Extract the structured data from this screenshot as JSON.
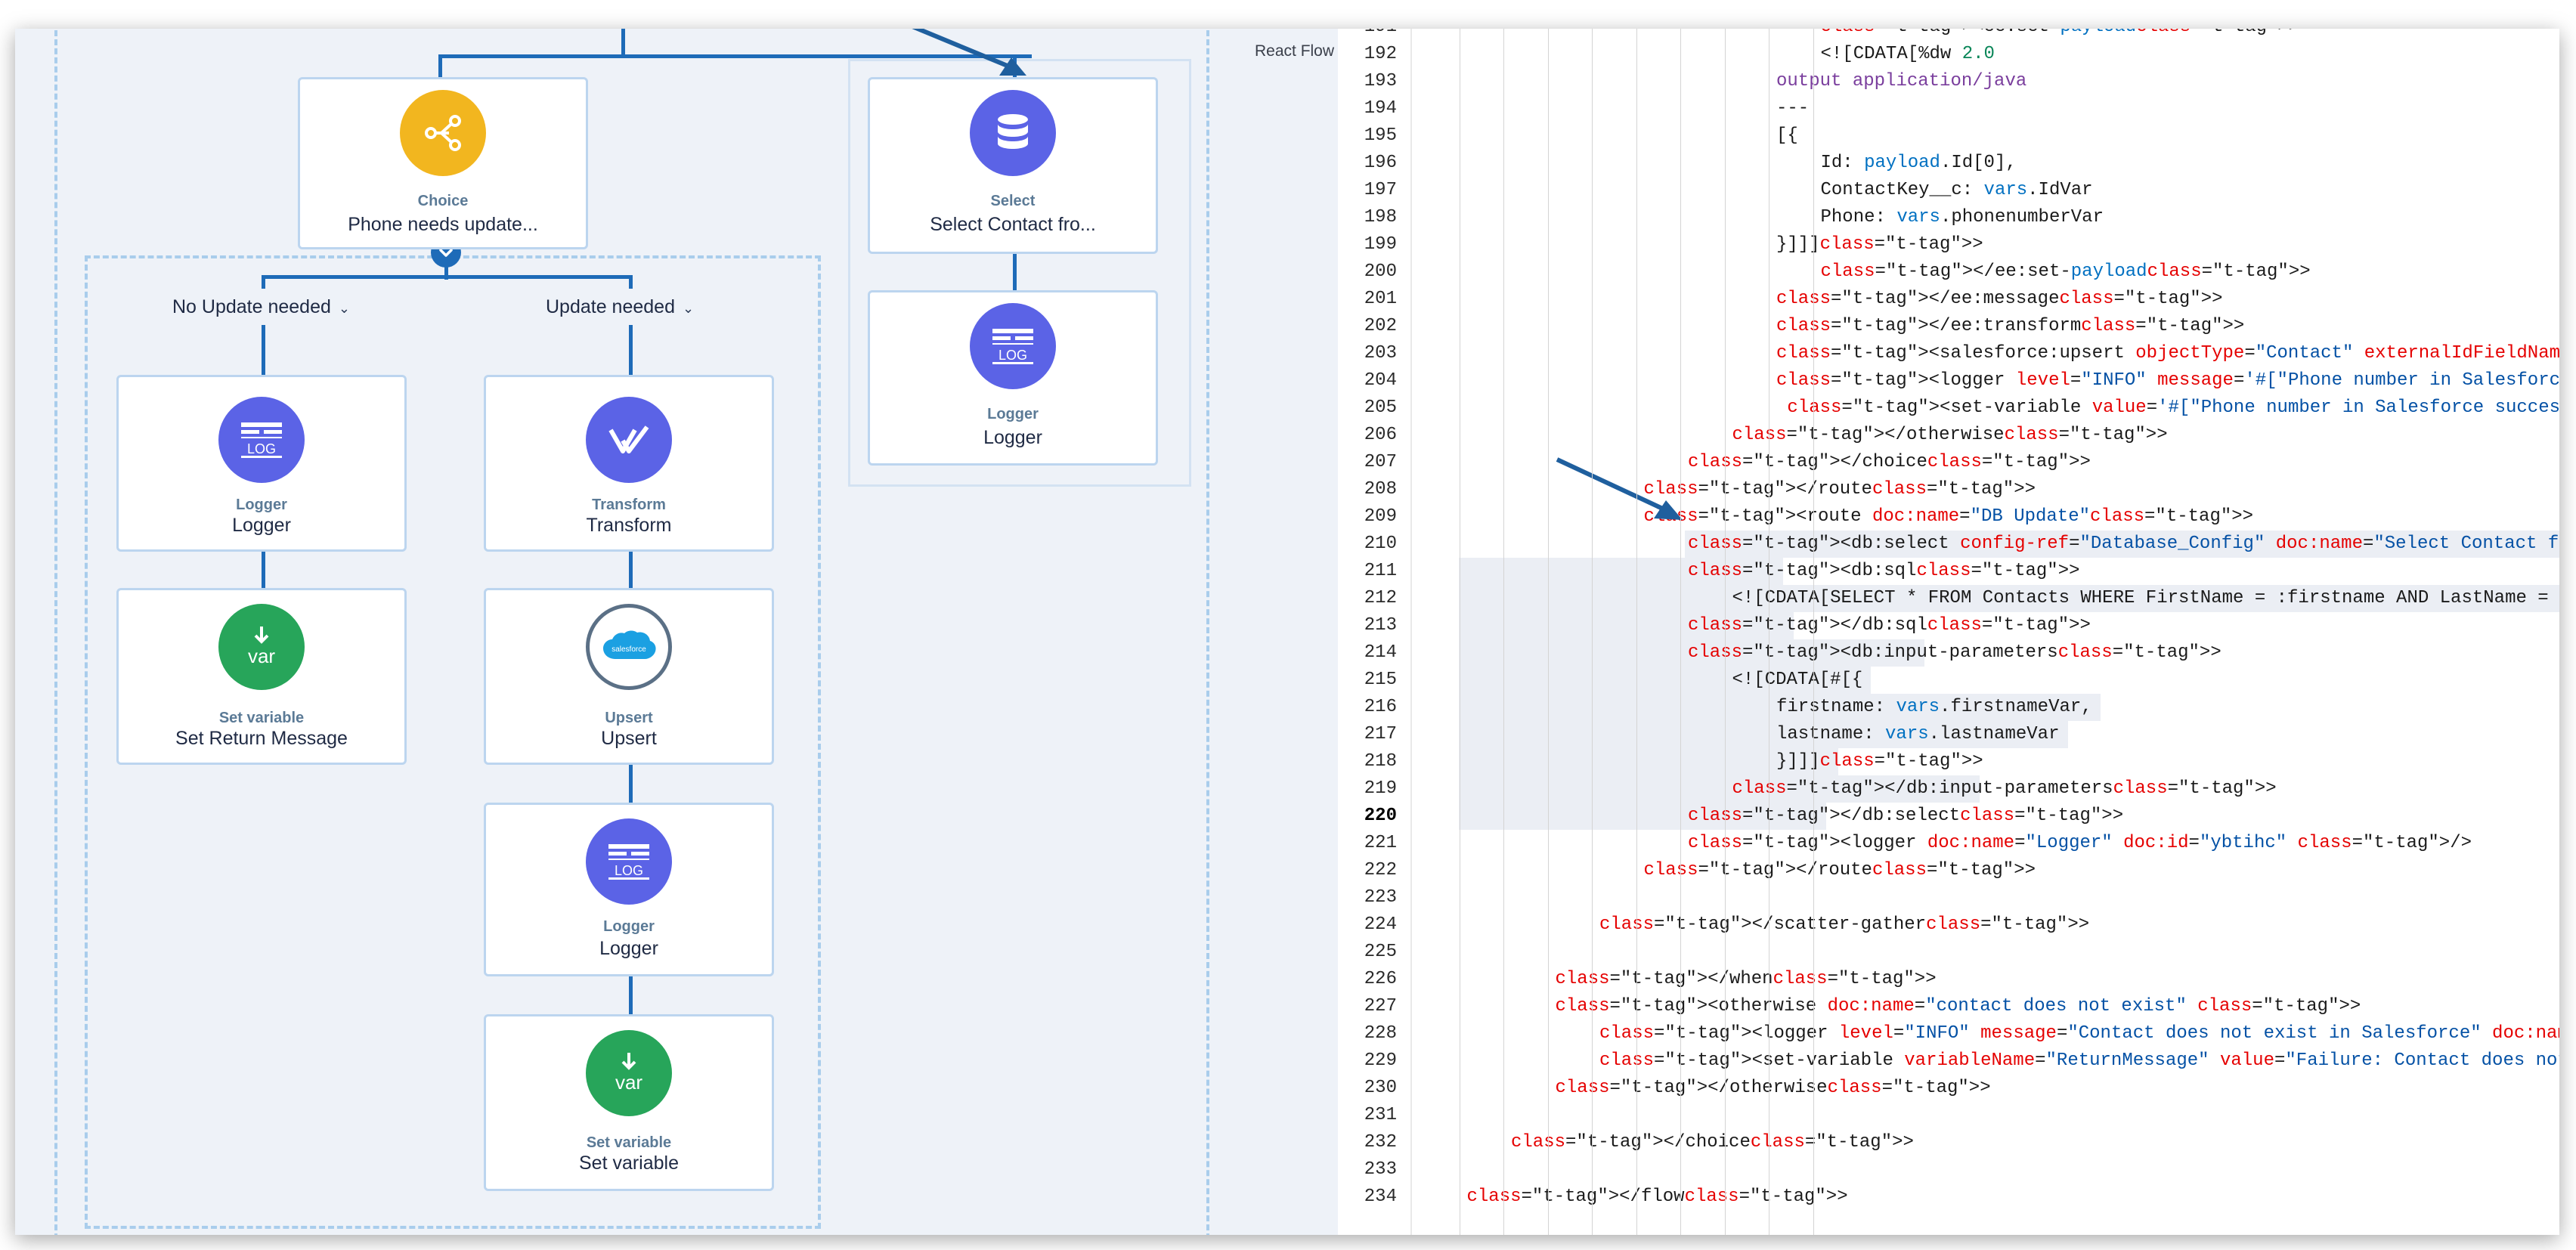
{
  "canvas": {
    "react_flow_label": "React Flow",
    "choice_node": {
      "type": "Choice",
      "label": "Phone needs update...",
      "icon": "branch-icon",
      "color": "#f2b61f"
    },
    "select_node": {
      "type": "Select",
      "label": "Select Contact fro...",
      "icon": "database-icon",
      "color": "#5b63e6"
    },
    "scatter_logger_node": {
      "type": "Logger",
      "label": "Logger",
      "icon": "log-icon",
      "color": "#5b63e6"
    },
    "branches": {
      "left": {
        "label": "No Update needed"
      },
      "right": {
        "label": "Update needed"
      }
    },
    "left_nodes": [
      {
        "type": "Logger",
        "label": "Logger",
        "icon": "log-icon",
        "color": "#5b63e6"
      },
      {
        "type": "Set variable",
        "label": "Set Return Message",
        "icon": "var-icon",
        "color": "#27a55a"
      }
    ],
    "right_nodes": [
      {
        "type": "Transform",
        "label": "Transform",
        "icon": "transform-icon",
        "color": "#5b63e6"
      },
      {
        "type": "Upsert",
        "label": "Upsert",
        "icon": "salesforce-icon",
        "color": "#ffffff"
      },
      {
        "type": "Logger",
        "label": "Logger",
        "icon": "log-icon",
        "color": "#5b63e6"
      },
      {
        "type": "Set variable",
        "label": "Set variable",
        "icon": "var-icon",
        "color": "#27a55a"
      }
    ],
    "var_icon_text": "var",
    "log_icon_text": "LOG",
    "salesforce_icon_text": "salesforce"
  },
  "editor": {
    "active_line": 220,
    "lines": [
      {
        "n": "191",
        "text": "<ee:set-payload>"
      },
      {
        "n": "192",
        "text": "<![CDATA[%dw 2.0"
      },
      {
        "n": "193",
        "text": "output application/java"
      },
      {
        "n": "194",
        "text": "---"
      },
      {
        "n": "195",
        "text": "[{"
      },
      {
        "n": "196",
        "text": "Id: payload.Id[0],"
      },
      {
        "n": "197",
        "text": "ContactKey__c: vars.IdVar"
      },
      {
        "n": "198",
        "text": "Phone: vars.phonenumberVar"
      },
      {
        "n": "199",
        "text": "}]]]>"
      },
      {
        "n": "200",
        "text": "</ee:set-payload>"
      },
      {
        "n": "201",
        "text": "</ee:message>"
      },
      {
        "n": "202",
        "text": "</ee:transform>"
      },
      {
        "n": "203",
        "text": "<salesforce:upsert objectType=\"Contact\" externalIdFieldName=\"ContactKey__c\""
      },
      {
        "n": "204",
        "text": "<logger level=\"INFO\" message='#[\"Phone number in Salesforce successfully up"
      },
      {
        "n": "205",
        "text": " <set-variable value='#[\"Phone number in Salesforce successfully updated. \""
      },
      {
        "n": "206",
        "text": "</otherwise>"
      },
      {
        "n": "207",
        "text": "</choice>"
      },
      {
        "n": "208",
        "text": "</route>"
      },
      {
        "n": "209",
        "text": "<route doc:name=\"DB Update\">"
      },
      {
        "n": "210",
        "text": "<db:select config-ref=\"Database_Config\" doc:name=\"Select Contact from DB\" doc:i"
      },
      {
        "n": "211",
        "text": "<db:sql>"
      },
      {
        "n": "212",
        "text": "<![CDATA[SELECT * FROM Contacts WHERE FirstName = :firstname AND LastName ="
      },
      {
        "n": "213",
        "text": "</db:sql>"
      },
      {
        "n": "214",
        "text": "<db:input-parameters>"
      },
      {
        "n": "215",
        "text": "<![CDATA[#[{"
      },
      {
        "n": "216",
        "text": "firstname: vars.firstnameVar,"
      },
      {
        "n": "217",
        "text": "lastname: vars.lastnameVar"
      },
      {
        "n": "218",
        "text": "}]]]>"
      },
      {
        "n": "219",
        "text": "</db:input-parameters>"
      },
      {
        "n": "220",
        "text": "</db:select>"
      },
      {
        "n": "221",
        "text": "<logger doc:name=\"Logger\" doc:id=\"ybtihc\" />"
      },
      {
        "n": "222",
        "text": "</route>"
      },
      {
        "n": "223",
        "text": ""
      },
      {
        "n": "224",
        "text": "</scatter-gather>"
      },
      {
        "n": "225",
        "text": ""
      },
      {
        "n": "226",
        "text": "</when>"
      },
      {
        "n": "227",
        "text": "<otherwise doc:name=\"contact does not exist\" >"
      },
      {
        "n": "228",
        "text": "<logger level=\"INFO\" message=\"Contact does not exist in Salesforce\" doc:name=\"Logger\"/>"
      },
      {
        "n": "229",
        "text": "<set-variable variableName=\"ReturnMessage\" value=\"Failure: Contact does not exist in Sa"
      },
      {
        "n": "230",
        "text": "</otherwise>"
      },
      {
        "n": "231",
        "text": ""
      },
      {
        "n": "232",
        "text": "</choice>"
      },
      {
        "n": "233",
        "text": ""
      },
      {
        "n": "234",
        "text": "</flow>"
      }
    ]
  }
}
